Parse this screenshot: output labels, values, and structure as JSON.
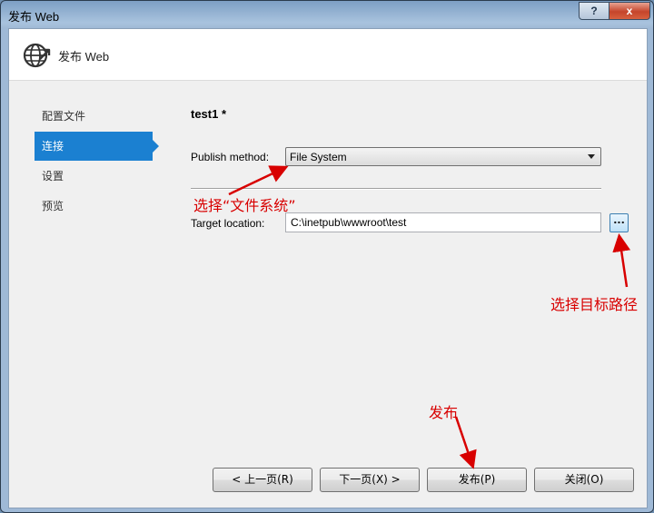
{
  "window": {
    "title": "发布 Web",
    "help_glyph": "?",
    "close_glyph": "x"
  },
  "header": {
    "title": "发布 Web"
  },
  "nav": {
    "items": [
      {
        "label": "配置文件"
      },
      {
        "label": "连接"
      },
      {
        "label": "设置"
      },
      {
        "label": "预览"
      }
    ],
    "active_index": 1
  },
  "main": {
    "profile_name": "test1 *",
    "publish_method_label": "Publish method:",
    "publish_method_value": "File System",
    "target_location_label": "Target location:",
    "target_location_value": "C:\\inetpub\\wwwroot\\test",
    "browse_label": "..."
  },
  "annotations": {
    "choose_fs": "选择“文件系统”",
    "choose_path": "选择目标路径",
    "publish": "发布"
  },
  "footer": {
    "prev": "< 上一页(R)",
    "next": "下一页(X) >",
    "publish": "发布(P)",
    "close": "关闭(O)"
  },
  "colors": {
    "accent": "#1b80d1",
    "annotation": "#d80000"
  }
}
